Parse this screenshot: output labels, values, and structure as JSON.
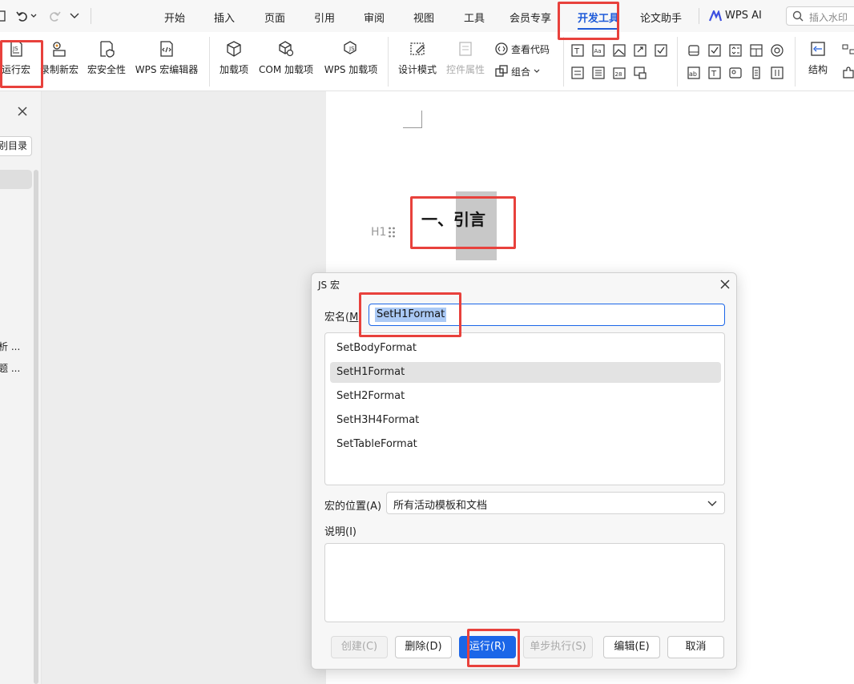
{
  "quick_access": {
    "undo_icon": "undo-icon",
    "redo_icon": "redo-icon"
  },
  "menu_tabs": [
    "开始",
    "插入",
    "页面",
    "引用",
    "审阅",
    "视图",
    "工具",
    "会员专享",
    "开发工具",
    "论文助手",
    "WPS AI"
  ],
  "active_tab": "开发工具",
  "search": {
    "placeholder": "插入水印"
  },
  "ribbon": {
    "run_macro": "运行宏",
    "record_macro": "录制新宏",
    "macro_security": "宏安全性",
    "wps_macro_editor": "WPS 宏编辑器",
    "addins": "加载项",
    "com_addins": "COM 加载项",
    "wps_addins": "WPS 加载项",
    "design_mode": "设计模式",
    "control_props": "控件属性",
    "view_code": "查看代码",
    "group": "组合",
    "structure": "结构"
  },
  "left_pane": {
    "close_icon": "close-icon",
    "toc_button": "别目录",
    "item1": "析 ...",
    "item2": "题 ..."
  },
  "document": {
    "heading_marker": "H1",
    "heading_text": "一、引言"
  },
  "dialog": {
    "title": "JS 宏",
    "macro_name_label": "宏名(M",
    "macro_name_label_key": "M",
    "macro_name_value": "SetH1Format",
    "macros": [
      "SetBodyFormat",
      "SetH1Format",
      "SetH2Format",
      "SetH3H4Format",
      "SetTableFormat"
    ],
    "selected_macro": "SetH1Format",
    "location_label": "宏的位置(A)",
    "location_value": "所有活动模板和文档",
    "description_label": "说明(I)",
    "description_value": "",
    "buttons": {
      "create": "创建(C)",
      "delete": "删除(D)",
      "run": "运行(R)",
      "step": "单步执行(S)",
      "edit": "编辑(E)",
      "cancel": "取消"
    }
  },
  "colors": {
    "accent": "#1f5bd8",
    "highlight_box": "#e8413c",
    "primary_button": "#1b66e8"
  }
}
